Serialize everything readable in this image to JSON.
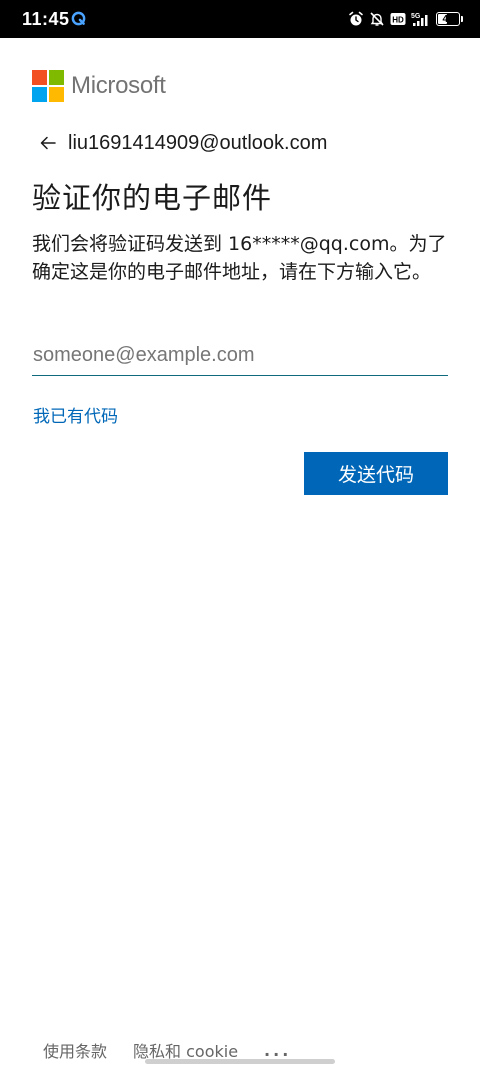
{
  "status_bar": {
    "time": "11:45",
    "battery": "40",
    "network": "5G",
    "icons": [
      "alarm-icon",
      "mute-bell-icon",
      "hd-icon",
      "signal-5g-icon",
      "battery-icon"
    ]
  },
  "brand": {
    "name": "Microsoft",
    "logo_colors": [
      "#f25022",
      "#7fba00",
      "#00a4ef",
      "#ffb900"
    ]
  },
  "identity": {
    "email": "liu1691414909@outlook.com"
  },
  "page": {
    "title": "验证你的电子邮件",
    "description": "我们会将验证码发送到 16*****@qq.com。为了确定这是你的电子邮件地址，请在下方输入它。"
  },
  "form": {
    "email_input": {
      "value": "",
      "placeholder": "someone@example.com"
    },
    "have_code_link": "我已有代码",
    "send_button": "发送代码"
  },
  "footer": {
    "terms": "使用条款",
    "privacy": "隐私和 cookie",
    "more": "..."
  },
  "colors": {
    "accent": "#0067b8",
    "input_underline": "#0f6a7e",
    "text": "#1b1b1b"
  }
}
